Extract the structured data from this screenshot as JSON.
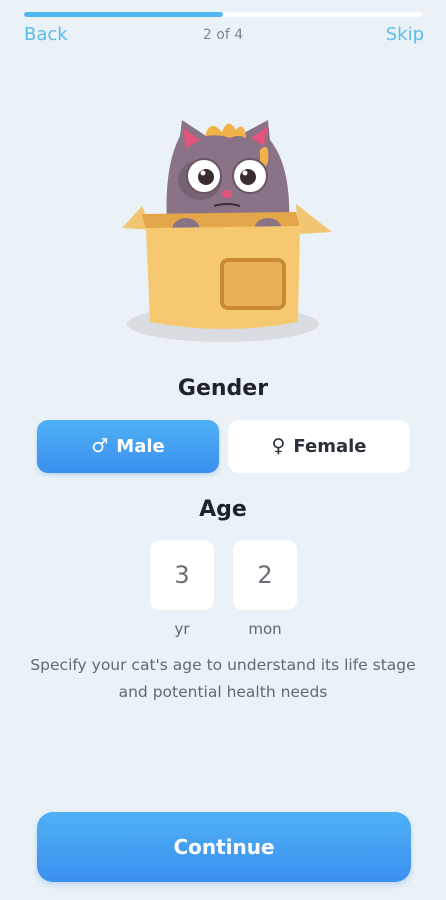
{
  "progress": {
    "fraction": 0.5
  },
  "topbar": {
    "back_label": "Back",
    "step_label": "2 of 4",
    "skip_label": "Skip"
  },
  "illustration": {
    "icon": "cat-in-box-illustration"
  },
  "gender": {
    "title": "Gender",
    "options": [
      {
        "label": "Male",
        "icon": "male-symbol",
        "selected": true
      },
      {
        "label": "Female",
        "icon": "female-symbol",
        "selected": false
      }
    ]
  },
  "age": {
    "title": "Age",
    "years_value": "3",
    "months_value": "2",
    "years_unit": "yr",
    "months_unit": "mon",
    "hint": "Specify your cat's age to understand its life stage and potential health needs"
  },
  "footer": {
    "continue_label": "Continue"
  },
  "colors": {
    "background": "#eaf2f8",
    "accent": "#4aa8f4",
    "link": "#5bbde9"
  }
}
